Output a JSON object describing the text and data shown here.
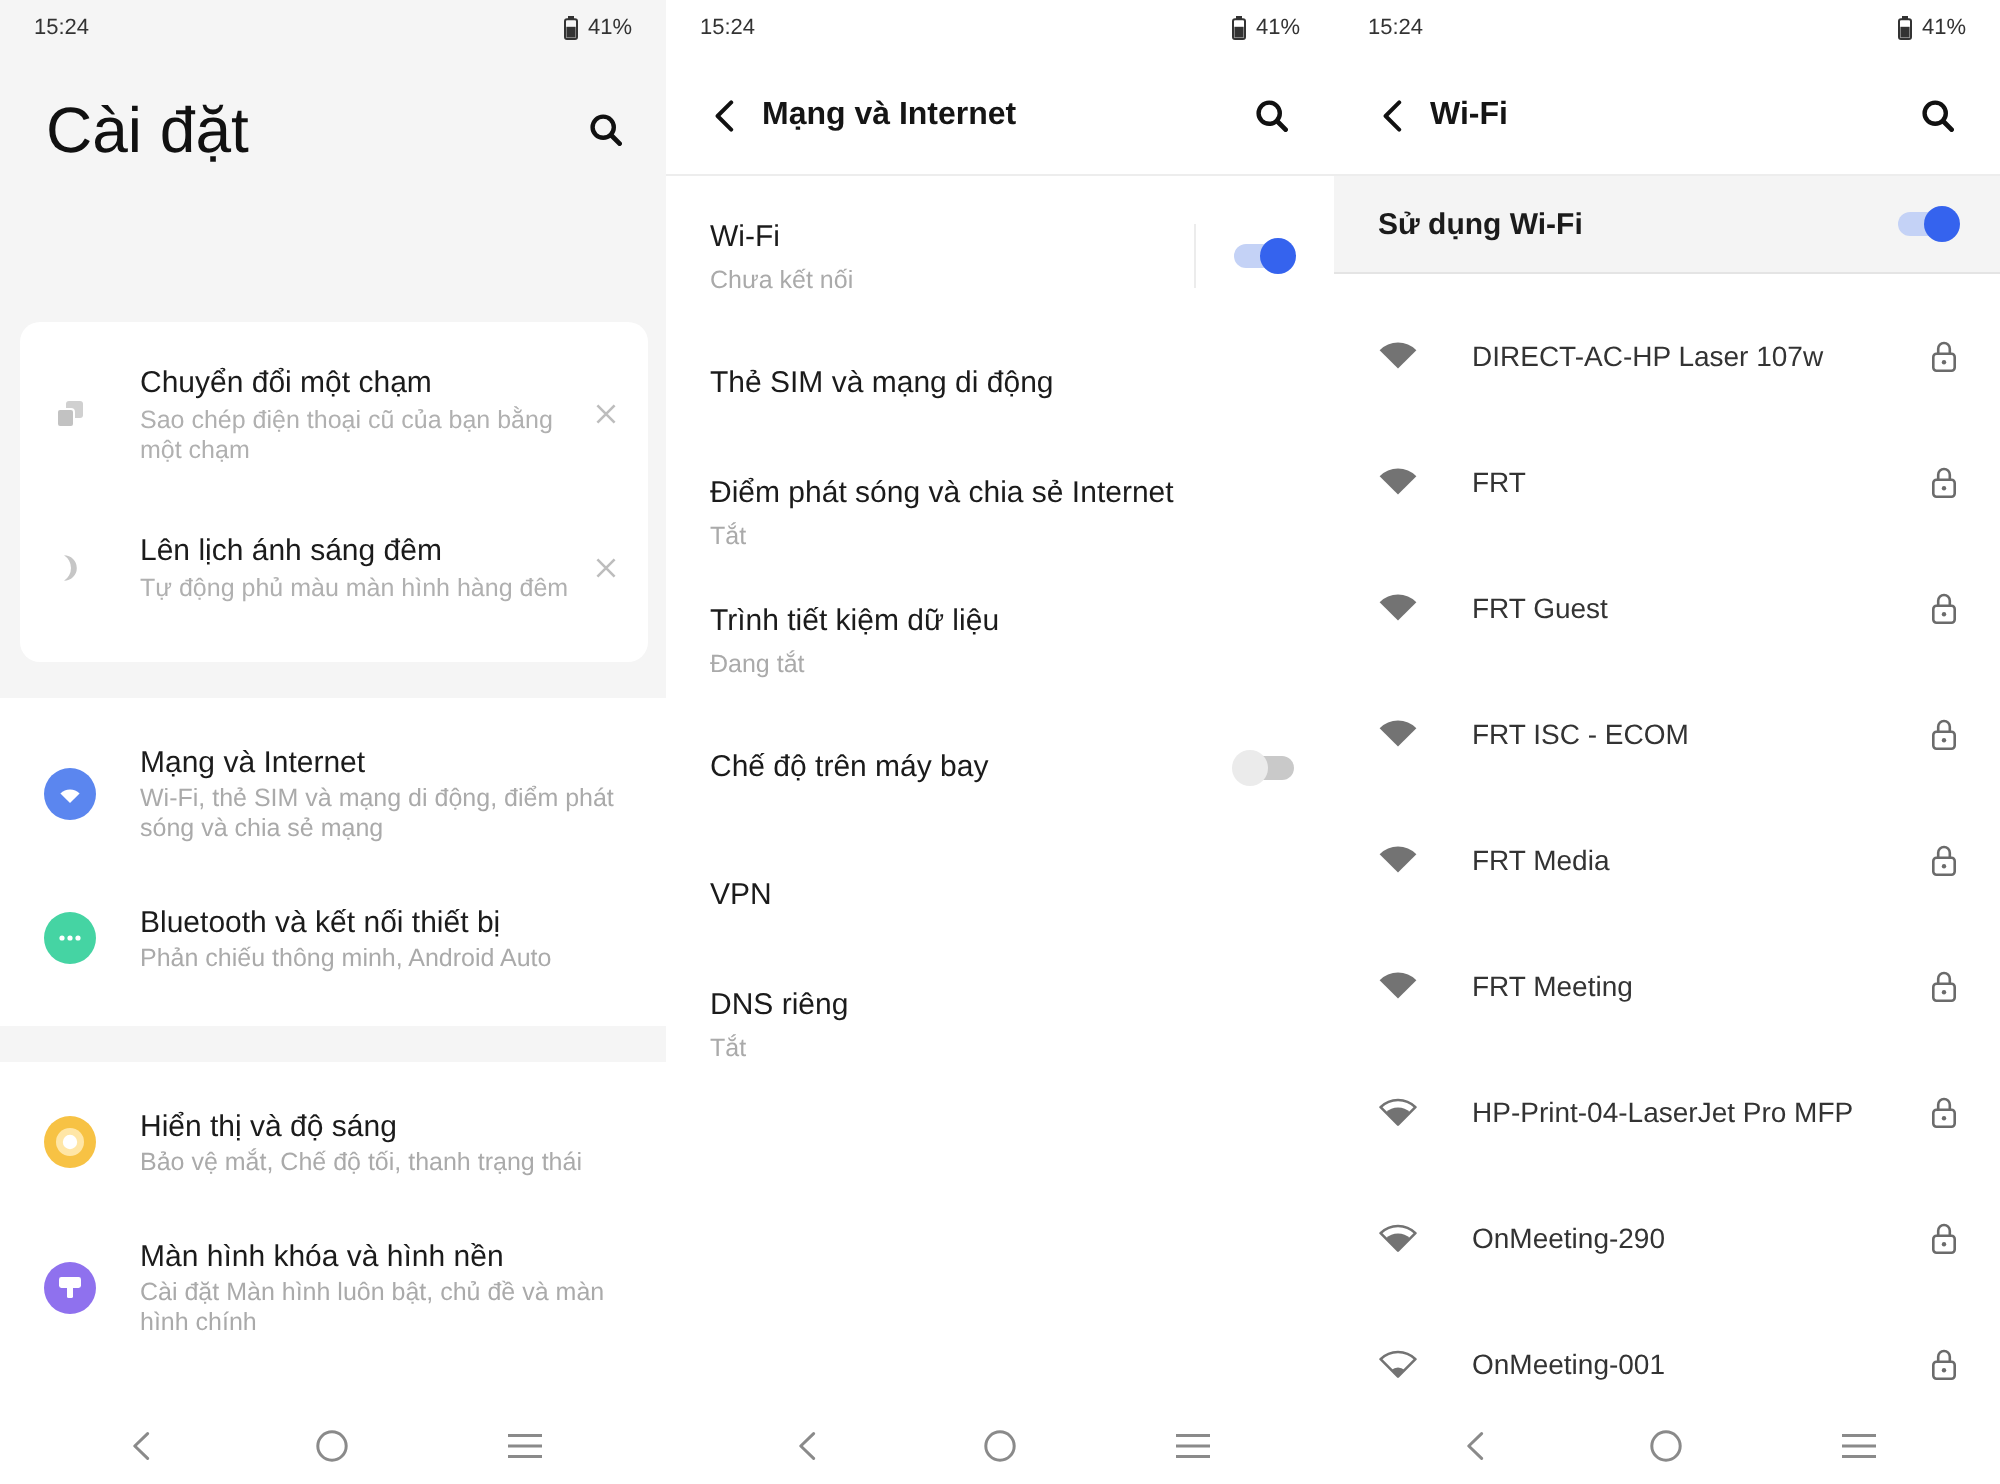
{
  "settings_home": {
    "status_bar": {
      "time": "15:24",
      "battery": "41%"
    },
    "title": "Cài đặt",
    "suggestions": [
      {
        "title": "Chuyển đổi một chạm",
        "subtitle": "Sao chép điện thoại cũ của bạn bằng một chạm"
      },
      {
        "title": "Lên lịch ánh sáng đêm",
        "subtitle": "Tự động phủ màu màn hình hàng đêm"
      }
    ],
    "groups": [
      {
        "items": [
          {
            "title": "Mạng và Internet",
            "subtitle": "Wi-Fi, thẻ SIM và mạng di động, điểm phát sóng và chia sẻ mạng",
            "color": "#5b86ef"
          },
          {
            "title": "Bluetooth và kết nối thiết bị",
            "subtitle": "Phản chiếu thông minh, Android Auto",
            "color": "#45d4a3"
          }
        ]
      },
      {
        "items": [
          {
            "title": "Hiển thị và độ sáng",
            "subtitle": "Bảo vệ mắt, Chế độ tối, thanh trạng thái",
            "color": "#f7c244"
          },
          {
            "title": "Màn hình khóa và hình nền",
            "subtitle": "Cài đặt Màn hình luôn bật, chủ đề và màn hình chính",
            "color": "#8f71ee"
          }
        ]
      }
    ]
  },
  "network_internet": {
    "status_bar": {
      "time": "15:24",
      "battery": "41%"
    },
    "title": "Mạng và Internet",
    "items": [
      {
        "kind": "split",
        "title": "Wi-Fi",
        "subtitle": "Chưa kết nối",
        "on": true
      },
      {
        "kind": "link",
        "title": "Thẻ SIM và mạng di động"
      },
      {
        "kind": "link",
        "title": "Điểm phát sóng và chia sẻ Internet",
        "subtitle": "Tắt"
      },
      {
        "kind": "link",
        "title": "Trình tiết kiệm dữ liệu",
        "subtitle": "Đang tắt"
      },
      {
        "kind": "switch",
        "title": "Chế độ trên máy bay",
        "on": false
      },
      {
        "kind": "link",
        "title": "VPN"
      },
      {
        "kind": "link",
        "title": "DNS riêng",
        "subtitle": "Tắt"
      }
    ]
  },
  "wifi": {
    "status_bar": {
      "time": "15:24",
      "battery": "41%"
    },
    "title": "Wi-Fi",
    "master_switch": {
      "label": "Sử dụng Wi-Fi",
      "on": true
    },
    "networks": [
      {
        "kind": "strong",
        "name": "DIRECT-AC-HP Laser 107w",
        "secured": true
      },
      {
        "kind": "strong",
        "name": "FRT",
        "secured": true
      },
      {
        "kind": "strong",
        "name": "FRT Guest",
        "secured": true
      },
      {
        "kind": "strong",
        "name": "FRT ISC - ECOM",
        "secured": true
      },
      {
        "kind": "strong",
        "name": "FRT Media",
        "secured": true
      },
      {
        "kind": "strong",
        "name": "FRT Meeting",
        "secured": true
      },
      {
        "kind": "medium",
        "name": "HP-Print-04-LaserJet Pro MFP",
        "secured": true
      },
      {
        "kind": "medium",
        "name": "OnMeeting-290",
        "secured": true
      },
      {
        "kind": "weak",
        "name": "OnMeeting-001",
        "secured": true
      }
    ]
  }
}
